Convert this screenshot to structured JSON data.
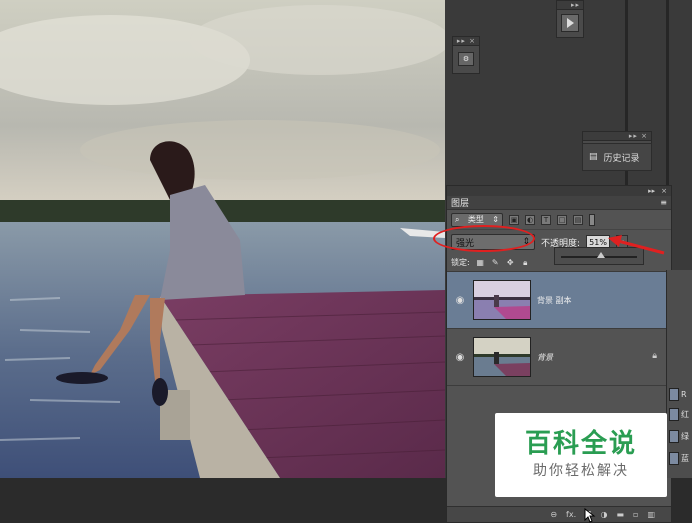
{
  "panels": {
    "history": {
      "label": "历史记录"
    }
  },
  "layers_panel": {
    "title": "图层",
    "filter": {
      "label": "类型"
    },
    "blend_mode": {
      "value": "强光"
    },
    "opacity": {
      "label": "不透明度:",
      "value": "51%"
    },
    "lock": {
      "label": "锁定:"
    },
    "layers": [
      {
        "name": "背景 副本",
        "selected": true,
        "visible": true
      },
      {
        "name": "背景",
        "selected": false,
        "visible": true,
        "locked": true
      }
    ],
    "bottom_buttons": [
      "link-icon",
      "fx-icon",
      "mask-icon",
      "adjustment-icon",
      "group-icon",
      "new-layer-icon",
      "trash-icon"
    ],
    "fx_label": "fx."
  },
  "channels": {
    "items": [
      "R",
      "红",
      "绿",
      "蓝"
    ]
  },
  "watermark": {
    "title": "百科全说",
    "subtitle": "助你轻松解决"
  },
  "colors": {
    "selection": "#6a7d95",
    "annotation": "#e02020",
    "brand_green": "#2a9d52"
  }
}
